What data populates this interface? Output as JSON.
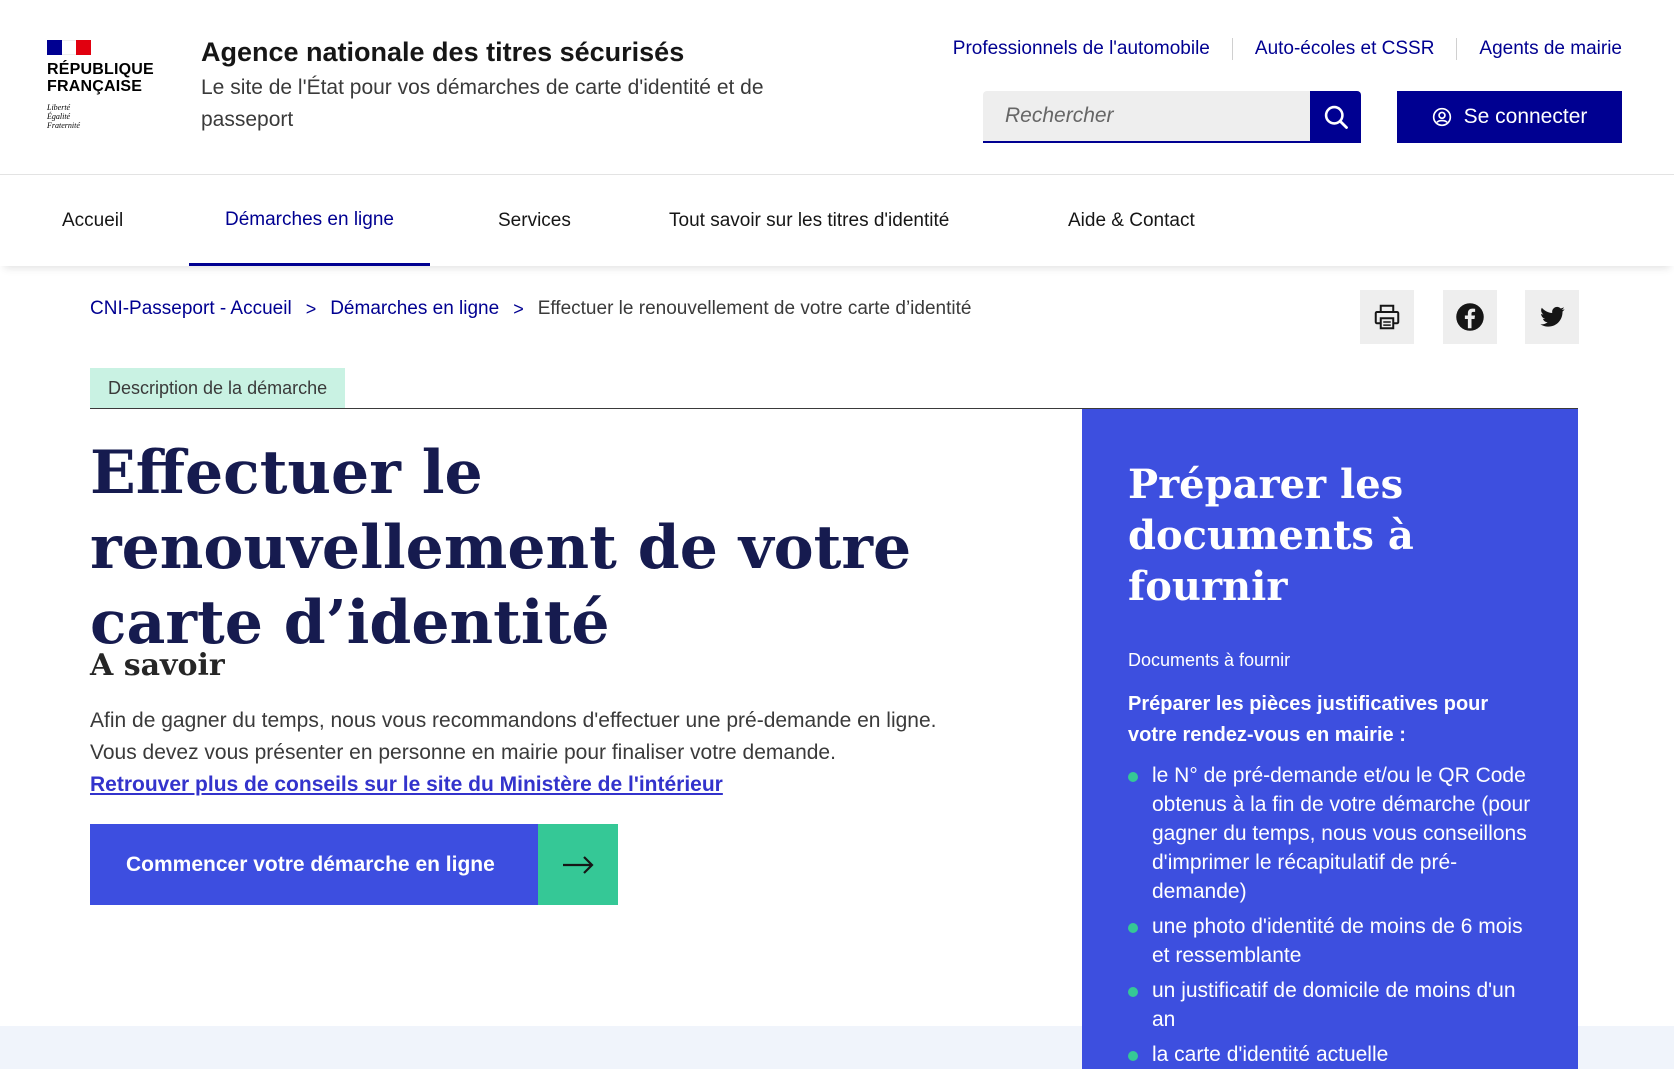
{
  "header": {
    "republic_line1": "RÉPUBLIQUE",
    "republic_line2": "FRANÇAISE",
    "devise": [
      "Liberté",
      "Égalité",
      "Fraternité"
    ],
    "agency_title": "Agence nationale des titres sécurisés",
    "agency_tagline": "Le site de l'État pour vos démarches de carte d'identité et de passeport",
    "top_links": [
      "Professionnels de l'automobile",
      "Auto-écoles et CSSR",
      "Agents de mairie"
    ],
    "search_placeholder": "Rechercher",
    "login_label": "Se connecter"
  },
  "nav": {
    "items": [
      {
        "label": "Accueil"
      },
      {
        "label": "Démarches en ligne",
        "active": true
      },
      {
        "label": "Services"
      },
      {
        "label": "Tout savoir sur les titres d'identité"
      },
      {
        "label": "Aide & Contact"
      }
    ]
  },
  "breadcrumb": {
    "items": [
      "CNI-Passeport - Accueil",
      "Démarches en ligne"
    ],
    "current": "Effectuer le renouvellement de votre carte d’identité",
    "separator": ">"
  },
  "share": {
    "icons": [
      "print-icon",
      "facebook-icon",
      "twitter-icon"
    ]
  },
  "main": {
    "tag": "Description de la démarche",
    "title": "Effectuer le renouvellement de votre carte d’identité",
    "savoir_heading": "A savoir",
    "paragraph_line1": "Afin de gagner du temps, nous vous recommandons d'effectuer une pré-demande en ligne.",
    "paragraph_line2": "Vous devez vous présenter en personne en mairie pour finaliser votre demande.",
    "link": "Retrouver plus de conseils sur le site du Ministère de l'intérieur",
    "cta_label": "Commencer votre démarche en ligne"
  },
  "panel": {
    "title": "Préparer les documents à fournir",
    "subtitle": "Documents à fournir",
    "lead": "Préparer les pièces justificatives pour votre rendez-vous en mairie :",
    "items": [
      "le N° de pré-demande et/ou le QR Code obtenus à la fin de votre démarche (pour gagner du temps, nous vous conseillons d'imprimer le récapitulatif de pré-demande)",
      "une photo d'identité de moins de 6 mois et ressemblante",
      "un justificatif de domicile de moins d'un an",
      "la carte d'identité actuelle"
    ]
  },
  "colors": {
    "brand_blue": "#000091",
    "cta_blue": "#3d4ee0",
    "accent_green": "#35c896",
    "tag_bg": "#c9f2e3",
    "panel_bg": "#3d4fdf",
    "flag_red": "#e1000f"
  }
}
